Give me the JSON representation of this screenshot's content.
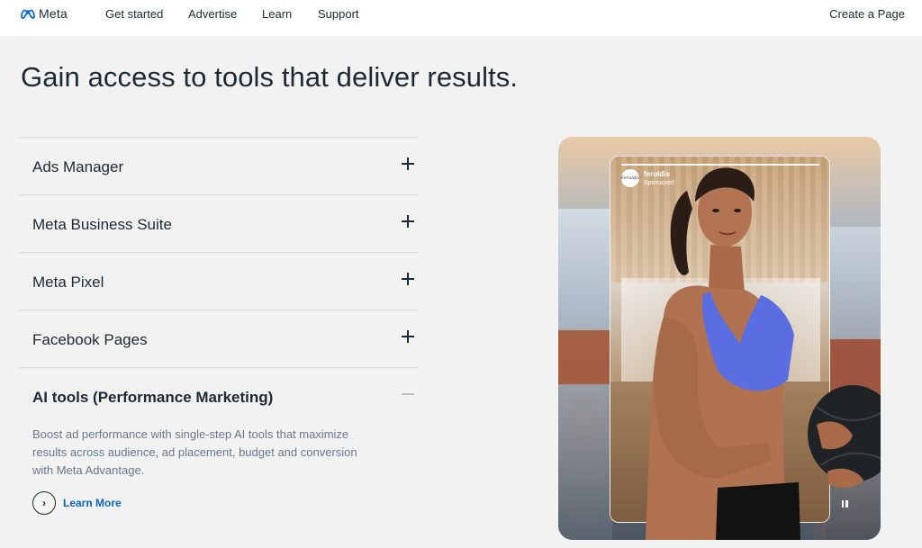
{
  "nav": {
    "logo_text": "Meta",
    "links": [
      "Get started",
      "Advertise",
      "Learn",
      "Support"
    ],
    "cta": "Create a Page"
  },
  "headline": "Gain access to tools that deliver results.",
  "accordion": {
    "items": [
      {
        "title": "Ads Manager",
        "expanded": false
      },
      {
        "title": "Meta Business Suite",
        "expanded": false
      },
      {
        "title": "Meta Pixel",
        "expanded": false
      },
      {
        "title": "Facebook Pages",
        "expanded": false
      },
      {
        "title": "AI tools (Performance Marketing)",
        "expanded": true
      }
    ],
    "expanded_body": "Boost ad performance with single-step AI tools that maximize results across audience, ad placement, budget and conversion with Meta Advantage.",
    "learn_more": "Learn More"
  },
  "hero": {
    "sponsor_avatar": "Feroldis",
    "sponsor_name": "feroldis",
    "sponsor_label": "Sponsored"
  },
  "colors": {
    "link_blue": "#0a66c2",
    "text_dark": "#1c2b33",
    "text_muted": "#67788a",
    "bra_blue": "#5b6ee1",
    "background": "#f2f2f2"
  },
  "icons": [
    "meta-logo-icon",
    "plus-icon",
    "minus-icon",
    "chevron-right-icon",
    "pause-icon"
  ]
}
